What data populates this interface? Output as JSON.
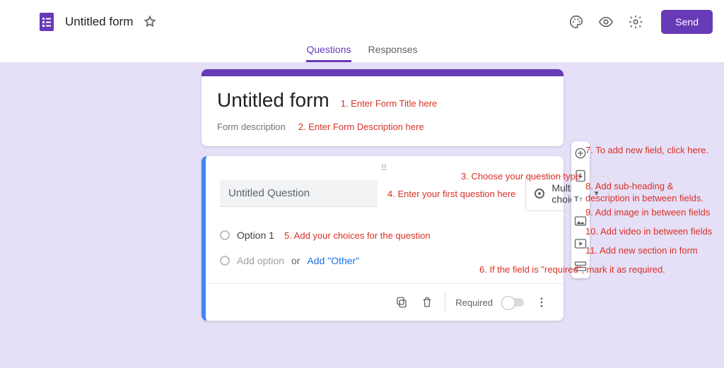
{
  "header": {
    "title": "Untitled form",
    "send": "Send"
  },
  "tabs": {
    "questions": "Questions",
    "responses": "Responses"
  },
  "form": {
    "title": "Untitled form",
    "description": "Form description"
  },
  "question": {
    "text": "Untitled Question",
    "type": "Multiple choice",
    "option1": "Option 1",
    "addOption": "Add option",
    "or": "or",
    "addOther": "Add \"Other\"",
    "required": "Required"
  },
  "annotations": {
    "a1": "1. Enter Form Title here",
    "a2": "2. Enter Form Description here",
    "a3": "3. Choose your question type",
    "a4": "4. Enter your first question here",
    "a5": "5. Add your choices for the question",
    "a6": "6. If the field is \"required\", mark it as required.",
    "a7": "7. To add new field, click here.",
    "a8": "8. Add sub-heading & description in between fields.",
    "a9": "9. Add image in between fields",
    "a10": "10. Add video in between fields",
    "a11": "11. Add new section in form"
  }
}
